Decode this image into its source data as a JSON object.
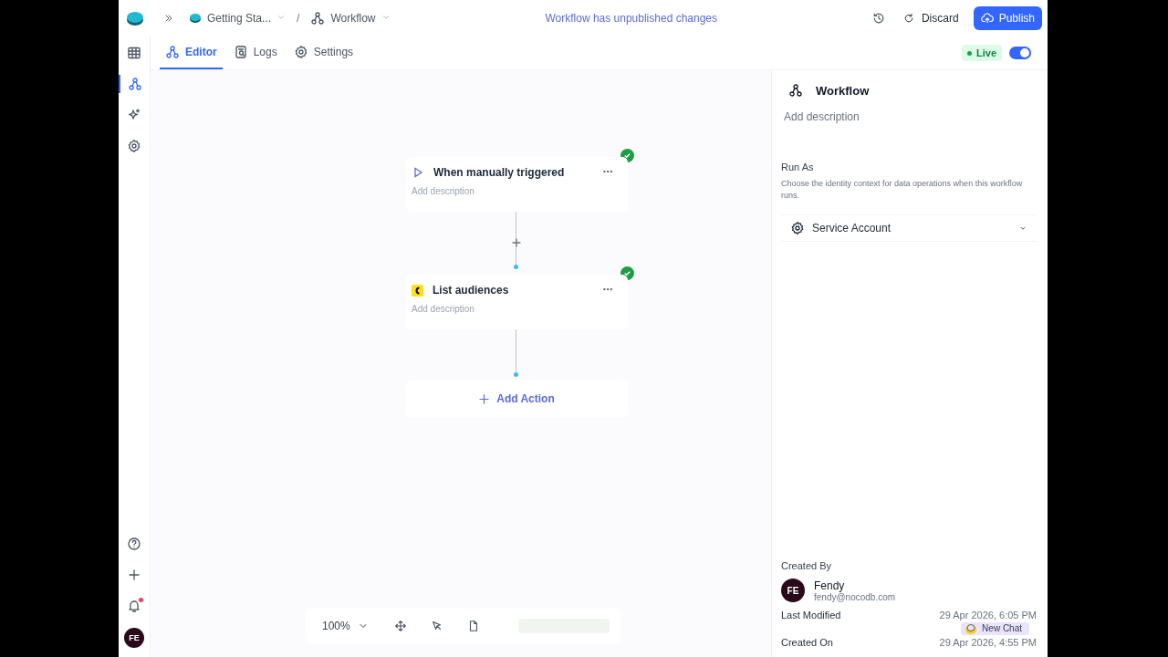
{
  "topbar": {
    "breadcrumbs": [
      {
        "label": "Getting Sta...",
        "kind": "base"
      },
      {
        "label": "Workflow",
        "kind": "workflow"
      }
    ],
    "separator": "/",
    "notice": "Workflow has unpublished changes",
    "discard": "Discard",
    "publish": "Publish"
  },
  "rail": {
    "items": [
      {
        "kind": "table",
        "selected": false
      },
      {
        "kind": "workflow",
        "selected": true
      },
      {
        "kind": "sparkle",
        "selected": false
      },
      {
        "kind": "gear",
        "selected": false
      }
    ],
    "bottom": [
      {
        "kind": "help"
      },
      {
        "kind": "plus"
      },
      {
        "kind": "bell"
      }
    ],
    "avatar": "FE"
  },
  "tabs": [
    {
      "label": "Editor",
      "kind": "workflow",
      "selected": true
    },
    {
      "label": "Logs",
      "kind": "logs",
      "selected": false
    },
    {
      "label": "Settings",
      "kind": "gear",
      "selected": false
    }
  ],
  "live": {
    "label": "Live",
    "on": true
  },
  "nodes": [
    {
      "title": "When manually triggered",
      "kind": "trigger",
      "placeholder": "Add description",
      "done": true
    },
    {
      "title": "List audiences",
      "kind": "mailchimp",
      "placeholder": "Add description",
      "done": true
    }
  ],
  "add_action": "Add Action",
  "toolbar": {
    "zoom": "100%"
  },
  "panel": {
    "title": "Workflow",
    "placeholder": "Add description",
    "run_as": {
      "label": "Run As",
      "hint": "Choose the identity context for data operations when this workflow runs.",
      "value": "Service Account"
    },
    "created_by": {
      "label": "Created By",
      "initials": "FE",
      "name": "Fendy",
      "email": "fendy@nocodb.com"
    },
    "meta": [
      {
        "label": "Last Modified",
        "value": "29 Apr 2026, 6:05 PM"
      },
      {
        "label": "Created On",
        "value": "29 Apr 2026, 4:55 PM"
      }
    ],
    "chat": "New Chat"
  }
}
